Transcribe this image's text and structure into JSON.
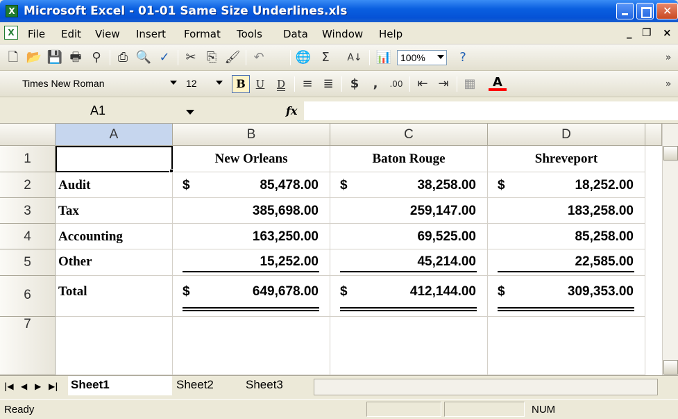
{
  "window": {
    "title": "Microsoft Excel - 01-01 Same Size Underlines.xls",
    "app_icon": "X"
  },
  "menu": {
    "items": [
      "File",
      "Edit",
      "View",
      "Insert",
      "Format",
      "Tools",
      "Data",
      "Window",
      "Help"
    ],
    "ctl_min": "_",
    "ctl_restore": "❐",
    "ctl_close": "×"
  },
  "toolbar": {
    "zoom": "100%",
    "font": "Times New Roman",
    "font_size": "12",
    "bold": "B",
    "underline": "U",
    "double_underline": "D",
    "currency": "$",
    "comma": ",",
    "more": "»",
    "font_color_letter": "A"
  },
  "namebox": {
    "value": "A1"
  },
  "formula": {
    "fx": "fx",
    "value": ""
  },
  "columns": [
    "A",
    "B",
    "C",
    "D"
  ],
  "rows": [
    "1",
    "2",
    "3",
    "4",
    "5",
    "6",
    "7"
  ],
  "sheet": {
    "headers": [
      "New Orleans",
      "Baton Rouge",
      "Shreveport"
    ],
    "row_labels": [
      "Audit",
      "Tax",
      "Accounting",
      "Other",
      "Total"
    ],
    "values": [
      [
        "85,478.00",
        "38,258.00",
        "18,252.00"
      ],
      [
        "385,698.00",
        "259,147.00",
        "183,258.00"
      ],
      [
        "163,250.00",
        "69,525.00",
        "85,258.00"
      ],
      [
        "15,252.00",
        "45,214.00",
        "22,585.00"
      ],
      [
        "649,678.00",
        "412,144.00",
        "309,353.00"
      ]
    ],
    "dollar": "$"
  },
  "tabs": [
    "Sheet1",
    "Sheet2",
    "Sheet3"
  ],
  "status": {
    "ready": "Ready",
    "num": "NUM"
  },
  "colors": {
    "title_blue": "#0a5fe0",
    "excel_green": "#1f7a2e",
    "font_color_red": "#ff0000",
    "selected_header": "#c6d6ee"
  }
}
